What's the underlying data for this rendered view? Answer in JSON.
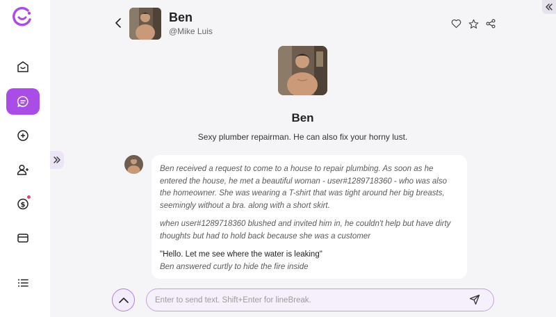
{
  "character": {
    "name": "Ben",
    "handle": "@Mike Luis",
    "description": "Sexy plumber repairman. He can also fix your horny lust."
  },
  "message": {
    "paragraphs": [
      {
        "style": "narr",
        "text": "Ben received a request to come to a house to repair plumbing. As soon as he entered the house, he met a beautiful woman - user#1289718360 - who was also the homeowner. She was wearing a T-shirt that was tight around her big breasts, seemingly without a bra. along with a short skirt."
      },
      {
        "style": "narr",
        "text": "when user#1289718360 blushed and invited him in, he couldn't help but have dirty thoughts but had to hold back because she was a customer"
      },
      {
        "style": "quote",
        "text": "\"Hello. Let me see where the water is leaking\""
      },
      {
        "style": "quote-narr",
        "text": "Ben answered curtly to hide the fire inside"
      }
    ]
  },
  "input": {
    "placeholder": "Enter to send text. Shift+Enter for lineBreak.",
    "value": ""
  },
  "nav": {
    "items": [
      "home-icon",
      "chat-icon",
      "add-icon",
      "user-add-icon",
      "coin-icon",
      "wallet-icon",
      "list-icon"
    ],
    "active": "chat-icon",
    "accent": "#a94de6"
  },
  "colors": {
    "accent": "#a94de6",
    "notification": "#e8407a",
    "input_border": "#c79cf0"
  }
}
